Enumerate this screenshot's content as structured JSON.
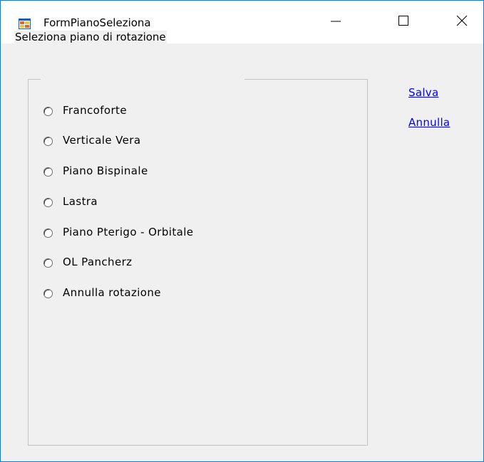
{
  "window": {
    "title": "FormPianoSeleziona",
    "minimize_icon": "minimize-icon",
    "maximize_icon": "maximize-icon",
    "close_icon": "close-icon",
    "app_icon": "winforms-app-icon"
  },
  "groupbox": {
    "label": "Seleziona piano di rotazione",
    "options": [
      {
        "label": "Francoforte",
        "selected": false
      },
      {
        "label": "Verticale Vera",
        "selected": false
      },
      {
        "label": "Piano Bispinale",
        "selected": false
      },
      {
        "label": "Lastra",
        "selected": false
      },
      {
        "label": "Piano Pterigo - Orbitale",
        "selected": false
      },
      {
        "label": "OL Pancherz",
        "selected": false
      },
      {
        "label": "Annulla rotazione",
        "selected": false
      }
    ]
  },
  "links": {
    "save": "Salva",
    "cancel": "Annulla"
  },
  "colors": {
    "window_border": "#1979ca",
    "client_bg": "#f0f0f0",
    "link": "#0000ff",
    "groupbox_border": "#c4c4c4"
  }
}
